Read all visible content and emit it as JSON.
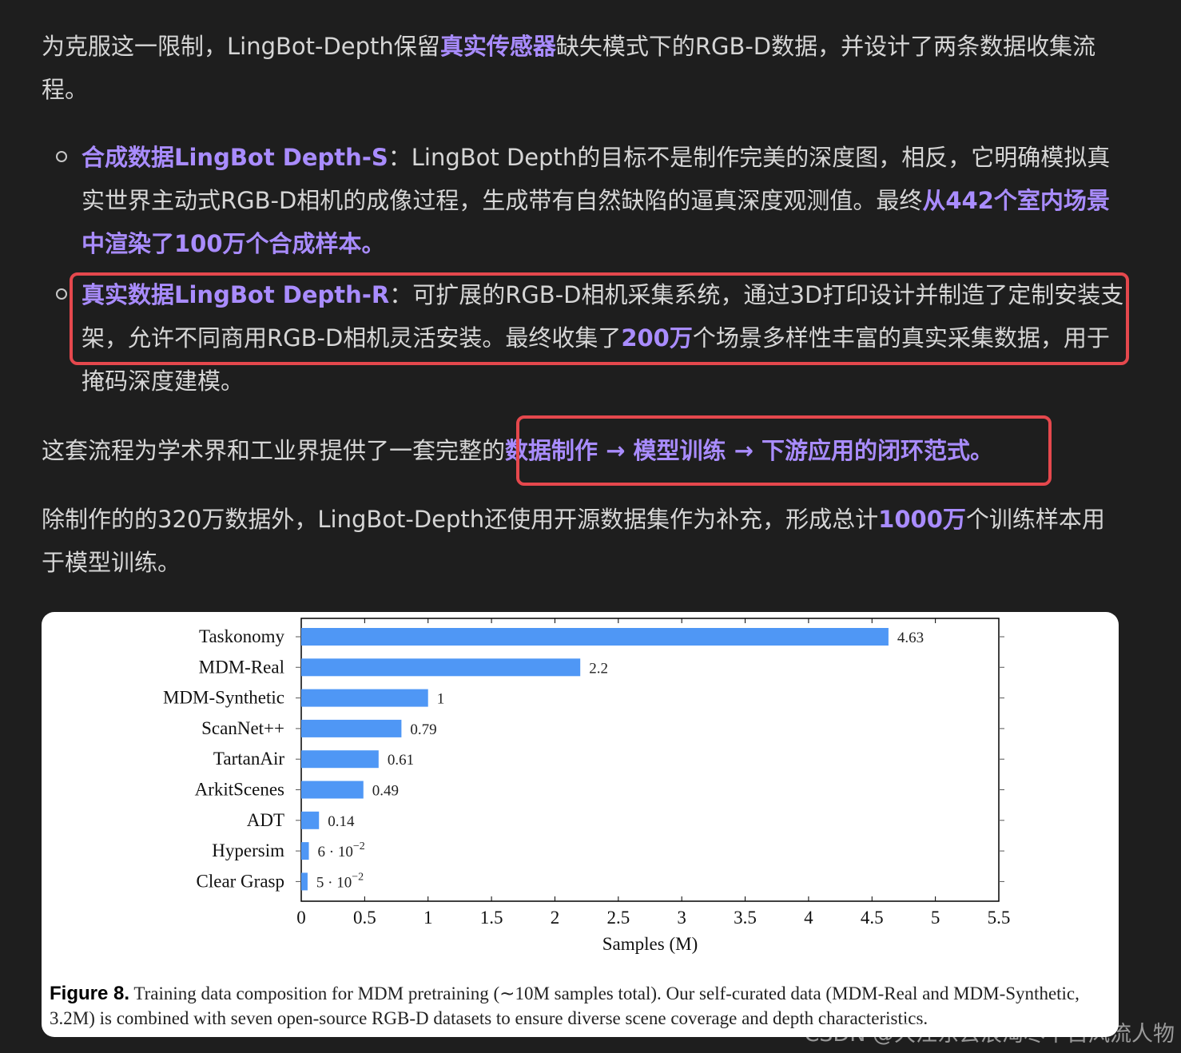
{
  "para1": {
    "t1": "为克服这一限制，LingBot-Depth保留",
    "h1": "真实传感器",
    "t2": "缺失模式下的RGB-D数据，并设计了两条数据收集流程。"
  },
  "bullets": [
    {
      "h1": "合成数据LingBot Depth-S",
      "t1": "：LingBot Depth的目标不是制作完美的深度图，相反，它明确模拟真实世界主动式RGB-D相机的成像过程，生成带有自然缺陷的逼真深度观测值。最终",
      "h2": "从442个室内场景中渲染了100万个合成样本。"
    },
    {
      "h1": "真实数据LingBot Depth-R",
      "t1": "：可扩展的RGB-D相机采集系统，通过3D打印设计并制造了定制安装支架，允许不同商用RGB-D相机灵活安装。最终收集了",
      "h2": "200万",
      "t2": "个场景多样性丰富的真实采集数据，用于掩码深度建模。"
    }
  ],
  "para2": {
    "t1": "这套流程为学术界和工业界提供了一套完整的",
    "h1": "数据制作 → 模型训练 → 下游应用的闭环范式。"
  },
  "para3": {
    "t1": "除制作的的320万数据外，LingBot-Depth还使用开源数据集作为补充，形成总计",
    "h1": "1000万",
    "t2": "个训练样本用于模型训练。"
  },
  "chart_data": {
    "type": "bar",
    "orientation": "horizontal",
    "categories": [
      "Taskonomy",
      "MDM-Real",
      "MDM-Synthetic",
      "ScanNet++",
      "TartanAir",
      "ArkitScenes",
      "ADT",
      "Hypersim",
      "Clear Grasp"
    ],
    "values": [
      4.63,
      2.2,
      1,
      0.79,
      0.61,
      0.49,
      0.14,
      0.06,
      0.05
    ],
    "value_labels": [
      {
        "text": "4.63"
      },
      {
        "text": "2.2"
      },
      {
        "text": "1"
      },
      {
        "text": "0.79"
      },
      {
        "text": "0.61"
      },
      {
        "text": "0.49"
      },
      {
        "text": "0.14"
      },
      {
        "text": "6 · 10",
        "sup": "−2"
      },
      {
        "text": "5 · 10",
        "sup": "−2"
      }
    ],
    "xlabel": "Samples (M)",
    "xlim": [
      0,
      5.5
    ],
    "xticks": [
      0,
      0.5,
      1,
      1.5,
      2,
      2.5,
      3,
      3.5,
      4,
      4.5,
      5,
      5.5
    ],
    "xtick_labels": [
      "0",
      "0.5",
      "1",
      "1.5",
      "2",
      "2.5",
      "3",
      "3.5",
      "4",
      "4.5",
      "5",
      "5.5"
    ],
    "bar_color": "#4f97f5",
    "grid": false
  },
  "caption": {
    "label": "Figure 8.",
    "text": " Training data composition for MDM pretraining (∼10M samples total). Our self-curated data (MDM-Real and MDM-Synthetic, 3.2M) is combined with seven open-source RGB-D datasets to ensure diverse scene coverage and depth characteristics."
  },
  "watermark": "CSDN @大江东去浪淘尽千古风流人物"
}
